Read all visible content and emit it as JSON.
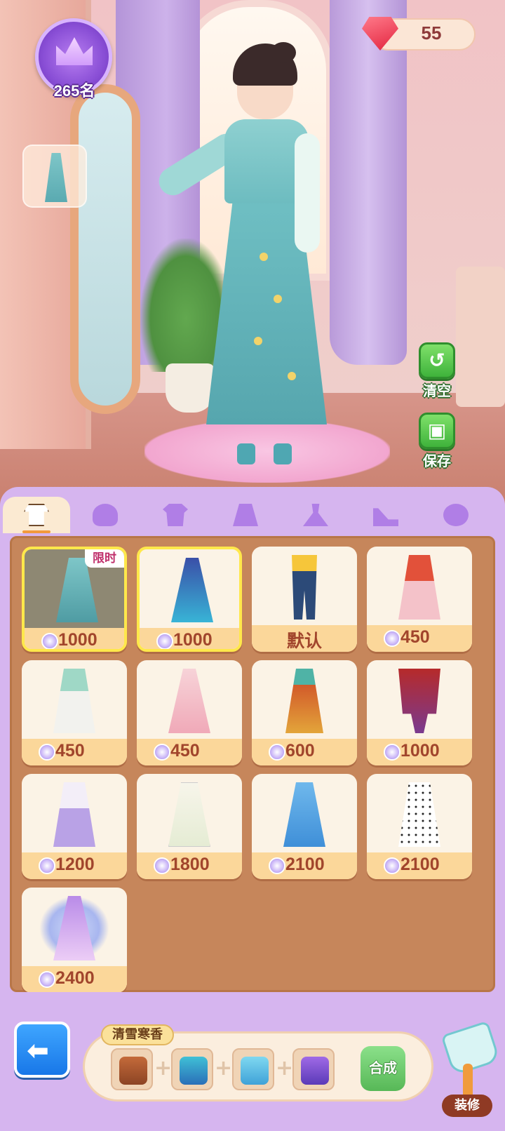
{
  "hud": {
    "rank_label": "265名",
    "gem_count": "55"
  },
  "side_buttons": {
    "clear_label": "清空",
    "save_label": "保存"
  },
  "tabs": [
    {
      "name": "full-outfit",
      "active": true
    },
    {
      "name": "hair",
      "active": false
    },
    {
      "name": "top",
      "active": false
    },
    {
      "name": "skirt",
      "active": false
    },
    {
      "name": "dress",
      "active": false
    },
    {
      "name": "shoes",
      "active": false
    },
    {
      "name": "accessory",
      "active": false
    }
  ],
  "items": [
    {
      "price": "1000",
      "tag": "限时",
      "state": "selected-dim"
    },
    {
      "price": "1000",
      "state": "selected"
    },
    {
      "price": "默认",
      "state": "default"
    },
    {
      "price": "450"
    },
    {
      "price": "450"
    },
    {
      "price": "450"
    },
    {
      "price": "600"
    },
    {
      "price": "1000"
    },
    {
      "price": "1200"
    },
    {
      "price": "1800"
    },
    {
      "price": "2100"
    },
    {
      "price": "2100"
    },
    {
      "price": "2400"
    }
  ],
  "recipe": {
    "title": "清雪寒香",
    "synthesize_label": "合成"
  },
  "decorate_label": "装修",
  "colors": {
    "panel": "#d6b5ef",
    "grid_bg": "#c6865b",
    "price_text": "#a1452c",
    "accent_green": "#57b857",
    "accent_blue": "#1877e8"
  }
}
